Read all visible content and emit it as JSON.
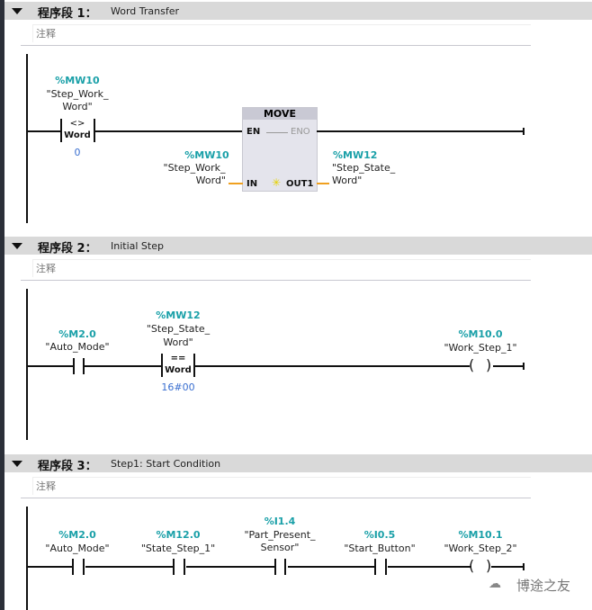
{
  "networks": [
    {
      "label": "程序段 1：",
      "title": "Word Transfer",
      "comment": "注释",
      "contact": {
        "address": "%MW10",
        "symbol1": "\"Step_Work_",
        "symbol2": "Word\"",
        "operator": "<>",
        "type": "Word",
        "operand2": "0"
      },
      "block": {
        "name": "MOVE",
        "en": "EN",
        "eno": "ENO",
        "in": "IN",
        "out": "OUT1",
        "in_operand": {
          "address": "%MW10",
          "symbol1": "\"Step_Work_",
          "symbol2": "Word\""
        },
        "out_operand": {
          "address": "%MW12",
          "symbol1": "\"Step_State_",
          "symbol2": "Word\""
        }
      }
    },
    {
      "label": "程序段 2：",
      "title": "Initial Step",
      "comment": "注释",
      "contact": {
        "address": "%M2.0",
        "symbol": "\"Auto_Mode\""
      },
      "compare": {
        "address": "%MW12",
        "symbol1": "\"Step_State_",
        "symbol2": "Word\"",
        "operator": "==",
        "type": "Word",
        "operand2": "16#00"
      },
      "coil": {
        "address": "%M10.0",
        "symbol": "\"Work_Step_1\""
      }
    },
    {
      "label": "程序段 3：",
      "title": "Step1: Start Condition",
      "comment": "注释",
      "contacts": [
        {
          "address": "%M2.0",
          "symbol": "\"Auto_Mode\""
        },
        {
          "address": "%M12.0",
          "symbol": "\"State_Step_1\""
        },
        {
          "address": "%I1.4",
          "symbol1": "\"Part_Present_",
          "symbol2": "Sensor\""
        },
        {
          "address": "%I0.5",
          "symbol": "\"Start_Button\""
        }
      ],
      "coil": {
        "address": "%M10.1",
        "symbol": "\"Work_Step_2\""
      }
    }
  ],
  "watermark": "博途之友",
  "colors": {
    "address": "#1aa0a8",
    "constant": "#3a6fd0",
    "wire_param": "#f0a020",
    "header": "#d9d9d9"
  }
}
